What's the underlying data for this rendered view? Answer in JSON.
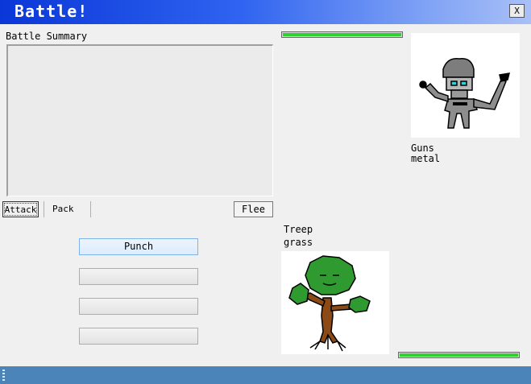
{
  "window": {
    "title": "Battle!",
    "close_label": "X"
  },
  "summary": {
    "heading": "Battle Summary",
    "log": ""
  },
  "tabs": [
    {
      "label": "Attack",
      "active": true
    },
    {
      "label": "Pack",
      "active": false
    }
  ],
  "flee_label": "Flee",
  "moves": [
    "Punch",
    "",
    "",
    ""
  ],
  "enemy": {
    "name": "Guns",
    "type": "metal",
    "hp_fraction": 1.0,
    "sprite": "robot-sprite"
  },
  "player": {
    "name": "Treep",
    "type": "grass",
    "hp_fraction": 1.0,
    "sprite": "tree-sprite"
  },
  "colors": {
    "hp_fill": "#2fd12f",
    "titlebar": "#0a37d8",
    "statusbar": "#4a84b8"
  }
}
